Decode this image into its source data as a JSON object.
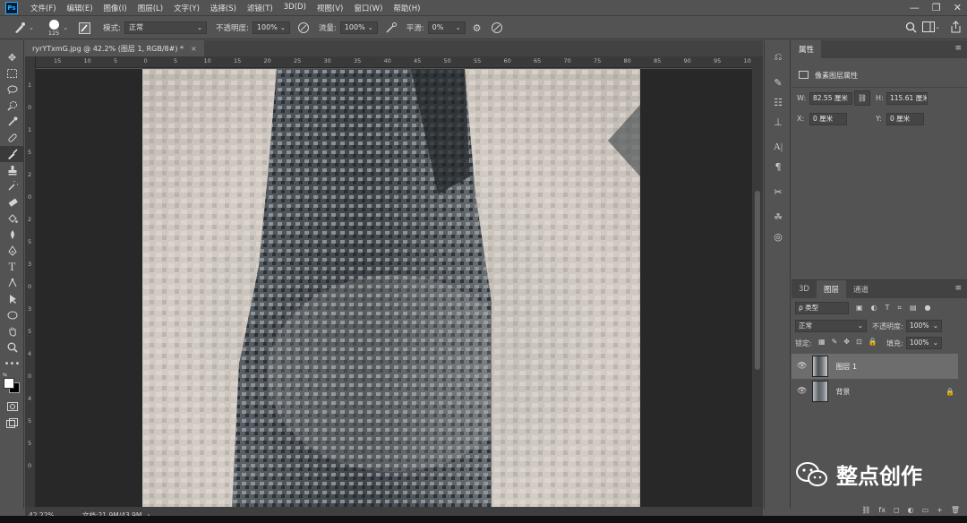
{
  "app": {
    "logo_text": "Ps"
  },
  "menu": [
    "文件(F)",
    "编辑(E)",
    "图像(I)",
    "图层(L)",
    "文字(Y)",
    "选择(S)",
    "滤镜(T)",
    "3D(D)",
    "视图(V)",
    "窗口(W)",
    "帮助(H)"
  ],
  "window_controls": [
    "—",
    "❐",
    "✕"
  ],
  "options": {
    "brush_size": "125",
    "mode_label": "模式:",
    "mode_value": "正常",
    "opacity_label": "不透明度:",
    "opacity_value": "100%",
    "flow_label": "流量:",
    "flow_value": "100%",
    "smooth_label": "平滑:",
    "smooth_value": "0%"
  },
  "document": {
    "tab_title": "ryrYTxmG.jpg @ 42.2% (图层 1, RGB/8#) *",
    "tab_close": "×"
  },
  "ruler_h_labels": [
    "15",
    "10",
    "5",
    "0",
    "5",
    "10",
    "15",
    "20",
    "25",
    "30",
    "35",
    "40",
    "45",
    "50",
    "55",
    "60",
    "65",
    "70",
    "75",
    "80",
    "85",
    "90",
    "95",
    "10"
  ],
  "ruler_v_labels": [
    "1",
    "0",
    "1",
    "5",
    "2",
    "0",
    "2",
    "5",
    "3",
    "0",
    "3",
    "5",
    "4",
    "0",
    "4",
    "5",
    "5",
    "0"
  ],
  "status": {
    "zoom": "42.22%",
    "doc_size": "文档:21.9M/43.9M"
  },
  "properties": {
    "title": "属性",
    "subtitle": "像素图层属性",
    "w_label": "W:",
    "w_value": "82.55 厘米",
    "h_label": "H:",
    "h_value": "115.61 厘米",
    "x_label": "X:",
    "x_value": "0 厘米",
    "y_label": "Y:",
    "y_value": "0 厘米"
  },
  "layers_panel": {
    "tabs": [
      "3D",
      "图层",
      "通道"
    ],
    "active_tab": "图层",
    "filter_label": "ρ 类型",
    "blend_mode": "正常",
    "opacity_label": "不透明度:",
    "opacity_value": "100%",
    "lock_label": "锁定:",
    "fill_label": "填充:",
    "fill_value": "100%",
    "layers": [
      {
        "name": "图层 1",
        "selected": true,
        "locked": false
      },
      {
        "name": "背景",
        "selected": false,
        "locked": true
      }
    ],
    "bottom_icons": [
      "⛓",
      "fx",
      "◻",
      "◐",
      "▭",
      "+",
      "🗑"
    ]
  },
  "watermark": {
    "text": "整点创作"
  },
  "colors": {
    "panel_bg": "#535353",
    "dark_bg": "#282828",
    "selected_layer": "#6d6d6d",
    "ps_blue": "#31a8ff"
  }
}
